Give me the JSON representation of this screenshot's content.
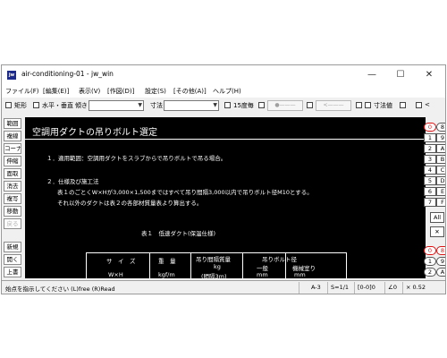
{
  "window": {
    "title": "air-conditioning-01 - jw_win",
    "app_icon_text": "jw",
    "controls": {
      "minimize": "—",
      "maximize": "☐",
      "close": "✕"
    }
  },
  "menu": [
    "ファイル(F)",
    "[編集(E)]",
    "表示(V)",
    "[作図(D)]",
    "設定(S)",
    "[その他(A)]",
    "ヘルプ(H)"
  ],
  "toolbar": {
    "rect_label": "矩形",
    "hv_label": "水平・垂直",
    "tilt_label": "傾き",
    "dim_label": "寸法",
    "deg15_label": "15度毎",
    "btn1_label": "●———",
    "btn2_label": "<———",
    "dimval_label": "寸法値",
    "last_label": "<"
  },
  "left_tools": [
    "範囲",
    "複線",
    "コーナー",
    "伸縮",
    "面取",
    "消去",
    "複写",
    "移動",
    "戻る",
    "新規",
    "開く",
    "上書"
  ],
  "right_layers": {
    "top": [
      "0",
      "8",
      "1",
      "9",
      "2",
      "A",
      "3",
      "B",
      "4",
      "C",
      "5",
      "D",
      "6",
      "E",
      "7",
      "F"
    ],
    "all_label": "All",
    "x_label": "✕",
    "bottom": [
      "0",
      "8",
      "1",
      "9",
      "2",
      "A"
    ]
  },
  "canvas": {
    "title": "空調用ダクトの吊りボルト選定",
    "item1": "１．適用範囲：空調用ダクトをスラブからで吊りボルトで吊る場合。",
    "item2": "２．仕様及び施工法",
    "item2_line1": "表１のごとくW×Hが3,000×1,500まではすべて吊り間隔3,000以内で吊りボルト径M10とする。",
    "item2_line2": "それ以外のダクトは表２の各部材質量表より算出する。",
    "table_caption": "表１　低速ダクト(保温仕様)",
    "table": {
      "size_label": "サ　イ　ズ",
      "size_unit": "W×H",
      "weight_label": "重　量",
      "weight_unit": "kgf/m",
      "span_weight_label": "吊り間隔質量",
      "span_weight_unit": "kg",
      "span_note": "(間隔3m)",
      "bolt_label": "吊りボルト径",
      "general_label": "一般",
      "machine_label": "機械室り",
      "mm1": "mm",
      "mm2": "mm"
    }
  },
  "status": {
    "message": "始点を指示してください (L)free (R)Read",
    "paper": "A-3",
    "scale": "S=1/1",
    "layer": "[0-0]0",
    "angle": "∠0",
    "zoom": "× 0.52"
  }
}
